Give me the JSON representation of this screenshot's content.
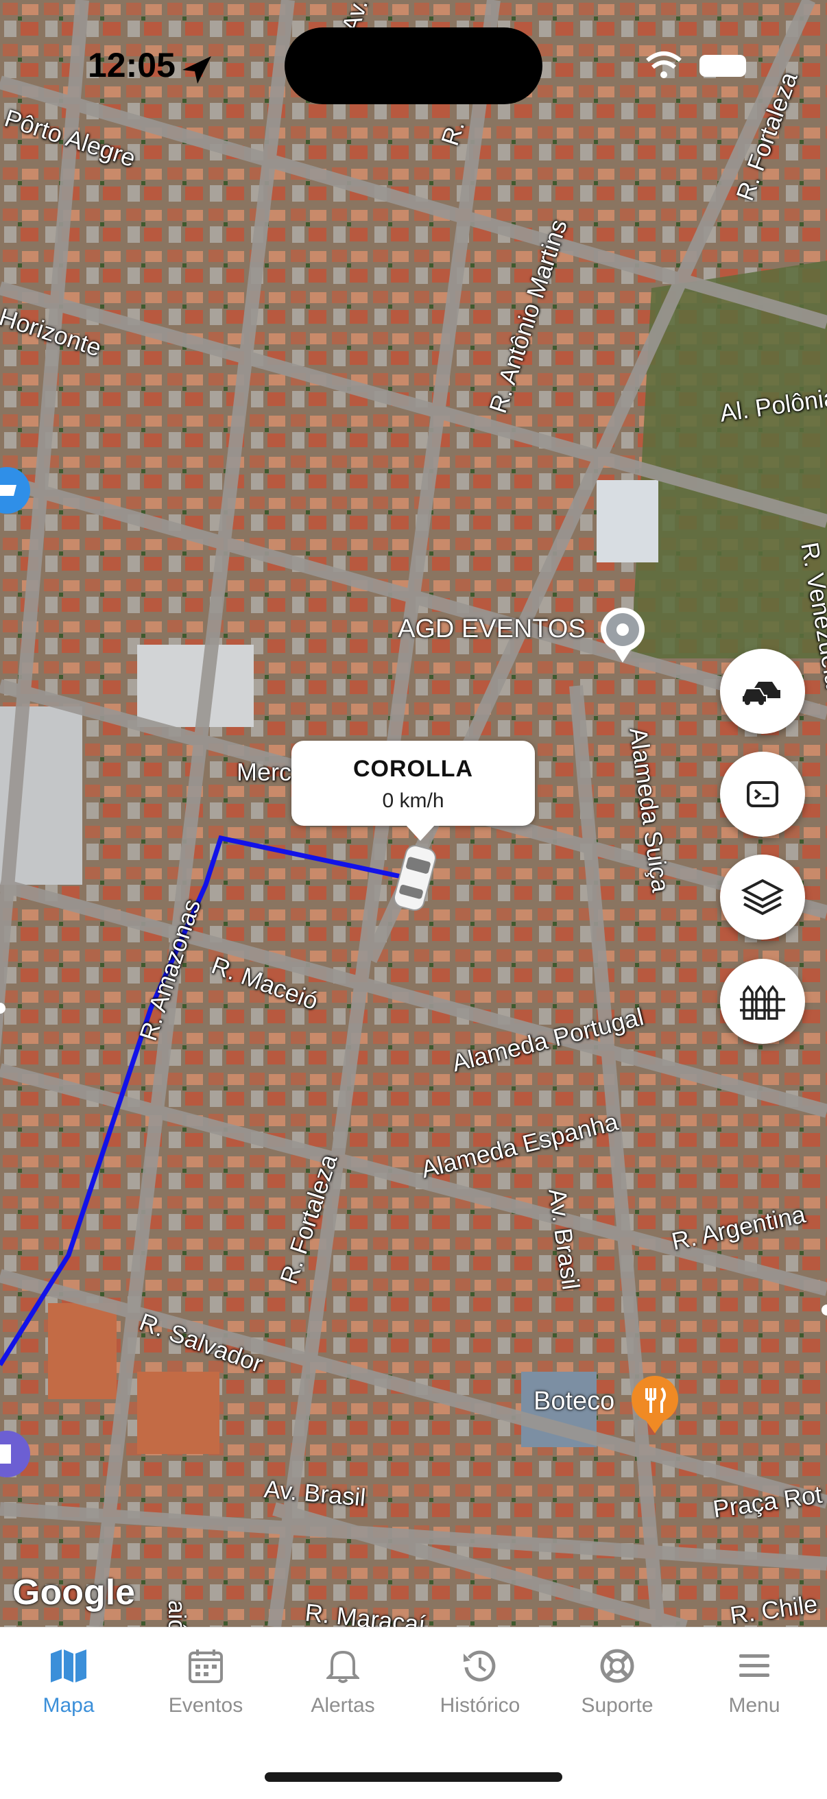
{
  "status_bar": {
    "time": "12:05"
  },
  "map": {
    "streets": [
      "Pôrto Alegre",
      "Horizonte",
      "R. Antônio Martins",
      "R. Fortaleza",
      "Al. Polônia",
      "R. Venezuela",
      "Alameda Suiça",
      "R. Amazonas",
      "R. Maceió",
      "Alameda Portugal",
      "Alameda Espanha",
      "R. Fortaleza",
      "Av. Brasil",
      "R. Argentina",
      "R. Salvador",
      "Av. Brasil",
      "Praça Rot",
      "R. Maracaí",
      "R. Chile",
      "Merc",
      "Av.",
      "R.",
      "aiós"
    ],
    "pois": {
      "agd": "AGD EVENTOS",
      "boteco": "Boteco"
    },
    "attribution": "Google"
  },
  "vehicle": {
    "name": "COROLLA",
    "speed": "0 km/h"
  },
  "fabs": {
    "vehicles": "cars-icon",
    "command": "terminal-icon",
    "layers": "layers-icon",
    "fence": "fence-icon"
  },
  "tabs": [
    {
      "label": "Mapa",
      "icon": "map-icon",
      "active": true
    },
    {
      "label": "Eventos",
      "icon": "calendar-icon",
      "active": false
    },
    {
      "label": "Alertas",
      "icon": "bell-icon",
      "active": false
    },
    {
      "label": "Histórico",
      "icon": "history-icon",
      "active": false
    },
    {
      "label": "Suporte",
      "icon": "lifebuoy-icon",
      "active": false
    },
    {
      "label": "Menu",
      "icon": "menu-icon",
      "active": false
    }
  ],
  "colors": {
    "accent": "#3b8fd9",
    "route": "#1212e8",
    "inactive_tab": "#8e8e8e"
  }
}
